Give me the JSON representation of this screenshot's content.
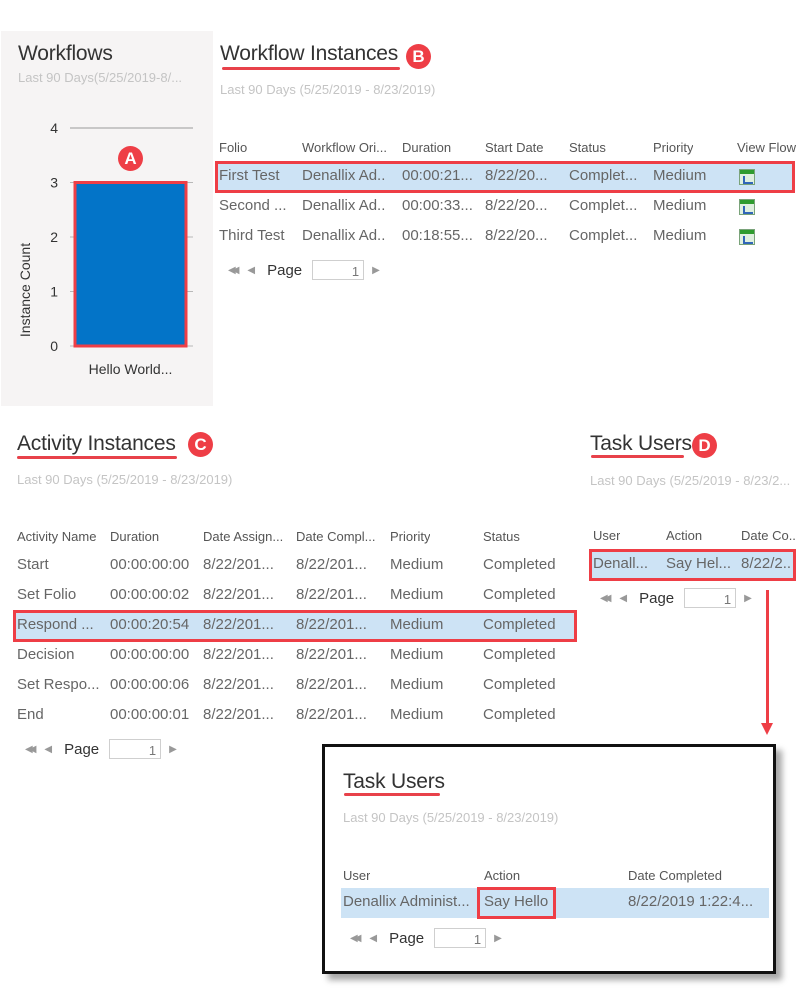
{
  "workflows_panel": {
    "title": "Workflows",
    "subtitle": "Last 90 Days(5/25/2019-8/...",
    "badge": "A"
  },
  "chart_data": {
    "type": "bar",
    "title": "Workflows",
    "subtitle": "Last 90 Days(5/25/2019-8/...",
    "categories": [
      "Hello World..."
    ],
    "values": [
      3
    ],
    "xlabel": "",
    "ylabel": "Instance Count",
    "ylim": [
      0,
      4
    ],
    "yticks": [
      "0",
      "1",
      "2",
      "3",
      "4"
    ],
    "grid": true,
    "bar_color": "#0374c8",
    "highlight_color": "#ee3e46"
  },
  "workflow_instances": {
    "title": "Workflow Instances",
    "badge": "B",
    "subtitle": "Last 90 Days (5/25/2019 - 8/23/2019)",
    "columns": [
      "Folio",
      "Workflow Ori...",
      "Duration",
      "Start Date",
      "Status",
      "Priority",
      "View Flow"
    ],
    "rows": [
      {
        "folio": "First Test",
        "originator": "Denallix Ad..",
        "duration": "00:00:21...",
        "start": "8/22/20...",
        "status": "Complet...",
        "priority": "Medium",
        "view_flow_icon": "view-flow-icon",
        "selected": true
      },
      {
        "folio": "Second ...",
        "originator": "Denallix Ad..",
        "duration": "00:00:33...",
        "start": "8/22/20...",
        "status": "Complet...",
        "priority": "Medium",
        "view_flow_icon": "view-flow-icon",
        "selected": false
      },
      {
        "folio": "Third Test",
        "originator": "Denallix Ad..",
        "duration": "00:18:55...",
        "start": "8/22/20...",
        "status": "Complet...",
        "priority": "Medium",
        "view_flow_icon": "view-flow-icon",
        "selected": false
      }
    ],
    "pager": {
      "label": "Page",
      "value": "1"
    }
  },
  "activity_instances": {
    "title": "Activity Instances",
    "badge": "C",
    "subtitle": "Last 90 Days (5/25/2019 - 8/23/2019)",
    "columns": [
      "Activity Name",
      "Duration",
      "Date Assign...",
      "Date Compl...",
      "Priority",
      "Status"
    ],
    "rows": [
      {
        "name": "Start",
        "duration": "00:00:00:00",
        "assigned": "8/22/201...",
        "completed": "8/22/201...",
        "priority": "Medium",
        "status": "Completed",
        "selected": false
      },
      {
        "name": "Set Folio",
        "duration": "00:00:00:02",
        "assigned": "8/22/201...",
        "completed": "8/22/201...",
        "priority": "Medium",
        "status": "Completed",
        "selected": false
      },
      {
        "name": "Respond ...",
        "duration": "00:00:20:54",
        "assigned": "8/22/201...",
        "completed": "8/22/201...",
        "priority": "Medium",
        "status": "Completed",
        "selected": true
      },
      {
        "name": "Decision",
        "duration": "00:00:00:00",
        "assigned": "8/22/201...",
        "completed": "8/22/201...",
        "priority": "Medium",
        "status": "Completed",
        "selected": false
      },
      {
        "name": "Set Respo...",
        "duration": "00:00:00:06",
        "assigned": "8/22/201...",
        "completed": "8/22/201...",
        "priority": "Medium",
        "status": "Completed",
        "selected": false
      },
      {
        "name": "End",
        "duration": "00:00:00:01",
        "assigned": "8/22/201...",
        "completed": "8/22/201...",
        "priority": "Medium",
        "status": "Completed",
        "selected": false
      }
    ],
    "pager": {
      "label": "Page",
      "value": "1"
    }
  },
  "task_users": {
    "title": "Task Users",
    "badge": "D",
    "subtitle": "Last 90 Days (5/25/2019 - 8/23/2...",
    "columns": [
      "User",
      "Action",
      "Date Co..."
    ],
    "rows": [
      {
        "user": "Denall...",
        "action": "Say Hel...",
        "date": "8/22/2..",
        "selected": true
      }
    ],
    "pager": {
      "label": "Page",
      "value": "1"
    }
  },
  "task_users_expanded": {
    "title": "Task Users",
    "subtitle": "Last 90 Days (5/25/2019 - 8/23/2019)",
    "columns": [
      "User",
      "Action",
      "Date Completed"
    ],
    "rows": [
      {
        "user": "Denallix Administ...",
        "action": "Say Hello",
        "date": "8/22/2019 1:22:4...",
        "selected": true
      }
    ],
    "pager": {
      "label": "Page",
      "value": "1"
    }
  },
  "pager_icons": {
    "first": "first-page-icon",
    "prev": "prev-page-icon",
    "next": "next-page-icon"
  }
}
